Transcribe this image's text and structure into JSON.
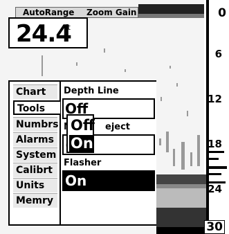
{
  "header": {
    "range_label": "AutoRange",
    "zoom_label": "Zoom Gain"
  },
  "depth": {
    "value": "24.4",
    "unit": "ft"
  },
  "depth_scale": [
    "0",
    "6",
    "12",
    "18",
    "24",
    "30"
  ],
  "tabs": [
    "Chart",
    "Tools",
    "Numbrs",
    "Alarms",
    "System",
    "Calibrt",
    "Units",
    "Memry"
  ],
  "selected_tab": "Tools",
  "fields": {
    "depth_line": {
      "label": "Depth Line",
      "value": "Off"
    },
    "noise_reject": {
      "label_visible": "N",
      "label_visible_end": "eject",
      "value_visible": "("
    },
    "flasher": {
      "label": "Flasher",
      "value": "On"
    }
  },
  "popup": {
    "options": [
      "Off",
      "On"
    ],
    "selected": "On"
  },
  "colors": {
    "background": "#f4f4f4",
    "panel": "#ffffff",
    "highlight": "#000000",
    "ink": "#000000"
  }
}
